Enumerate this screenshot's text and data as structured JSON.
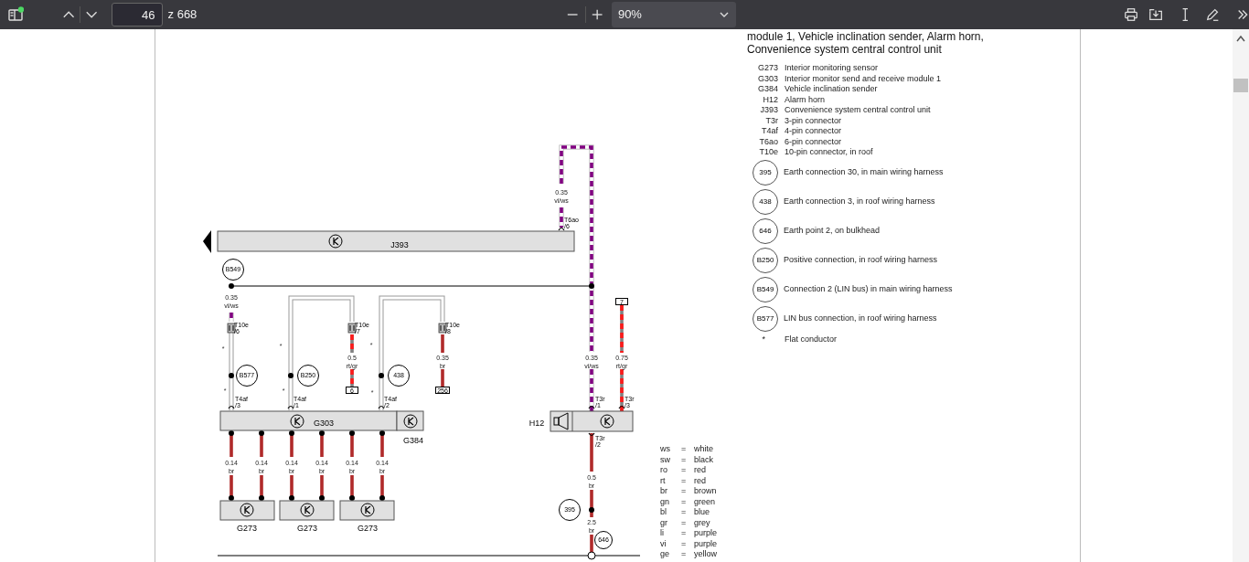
{
  "toolbar": {
    "page_number": "46",
    "page_count": "z 668",
    "zoom": "90%"
  },
  "page": {
    "title": "module 1, Vehicle inclination sender, Alarm horn, Convenience system central control unit",
    "legend": [
      {
        "kind": "code",
        "code": "G273",
        "text": "Interior monitoring sensor"
      },
      {
        "kind": "code",
        "code": "G303",
        "text": "Interior monitor send and receive module 1"
      },
      {
        "kind": "code",
        "code": "G384",
        "text": "Vehicle inclination sender"
      },
      {
        "kind": "code",
        "code": "H12",
        "text": "Alarm horn"
      },
      {
        "kind": "code",
        "code": "J393",
        "text": "Convenience system central control unit"
      },
      {
        "kind": "code",
        "code": "T3r",
        "text": "3-pin connector"
      },
      {
        "kind": "code",
        "code": "T4af",
        "text": "4-pin connector"
      },
      {
        "kind": "code",
        "code": "T6ao",
        "text": "6-pin connector"
      },
      {
        "kind": "code",
        "code": "T10e",
        "text": "10-pin connector, in roof"
      },
      {
        "kind": "circle",
        "code": "395",
        "text": "Earth connection 30, in main wiring harness"
      },
      {
        "kind": "circle",
        "code": "438",
        "text": "Earth connection 3, in roof wiring harness"
      },
      {
        "kind": "circle",
        "code": "646",
        "text": "Earth point 2, on bulkhead"
      },
      {
        "kind": "circle",
        "code": "B250",
        "text": "Positive connection, in roof wiring harness"
      },
      {
        "kind": "circle",
        "code": "B549",
        "text": "Connection 2 (LIN bus) in main wiring harness"
      },
      {
        "kind": "circle",
        "code": "B577",
        "text": "LIN bus connection, in roof wiring harness"
      },
      {
        "kind": "note",
        "code": "*",
        "text": "Flat conductor"
      }
    ],
    "diagram": {
      "units": [
        "J393",
        "G303",
        "G384",
        "H12",
        "G273",
        "G273",
        "G273"
      ],
      "wire_labels": [
        {
          "size": "0.35",
          "insulation": "vi/ws"
        },
        {
          "size": "0.35",
          "insulation": "vi/ws"
        },
        {
          "size": "0.5",
          "insulation": "rt/gr"
        },
        {
          "size": "0.35",
          "insulation": "br"
        },
        {
          "size": "0.35",
          "insulation": "vi/ws"
        },
        {
          "size": "0.75",
          "insulation": "rt/gr"
        },
        {
          "size": "0.14",
          "insulation": "br"
        },
        {
          "size": "0.14",
          "insulation": "br"
        },
        {
          "size": "0.14",
          "insulation": "br"
        },
        {
          "size": "0.14",
          "insulation": "br"
        },
        {
          "size": "0.14",
          "insulation": "br"
        },
        {
          "size": "0.14",
          "insulation": "br"
        },
        {
          "size": "0.5",
          "insulation": "br"
        },
        {
          "size": "2.5",
          "insulation": "br"
        }
      ],
      "connectors": [
        {
          "name": "T6ao",
          "pin": "/6"
        },
        {
          "name": "T10e",
          "pin": "/6"
        },
        {
          "name": "T10e",
          "pin": "/7"
        },
        {
          "name": "T10e",
          "pin": "/8"
        },
        {
          "name": "T4af",
          "pin": "/3"
        },
        {
          "name": "T4af",
          "pin": "/1"
        },
        {
          "name": "T4af",
          "pin": "/2"
        },
        {
          "name": "T3r",
          "pin": "/1"
        },
        {
          "name": "T3r",
          "pin": "/3"
        },
        {
          "name": "T3r",
          "pin": "/2"
        }
      ],
      "junctions": [
        "B549",
        "B577",
        "B250",
        "438",
        "395",
        "646"
      ],
      "terminals": [
        "6",
        "256",
        "7"
      ],
      "flat_marks": [
        "*",
        "*",
        "*",
        "*",
        "*",
        "*"
      ]
    },
    "color_key": [
      {
        "abbr": "ws",
        "eq": "=",
        "name": "white"
      },
      {
        "abbr": "sw",
        "eq": "=",
        "name": "black"
      },
      {
        "abbr": "ro",
        "eq": "=",
        "name": "red"
      },
      {
        "abbr": "rt",
        "eq": "=",
        "name": "red"
      },
      {
        "abbr": "br",
        "eq": "=",
        "name": "brown"
      },
      {
        "abbr": "gn",
        "eq": "=",
        "name": "green"
      },
      {
        "abbr": "bl",
        "eq": "=",
        "name": "blue"
      },
      {
        "abbr": "gr",
        "eq": "=",
        "name": "grey"
      },
      {
        "abbr": "li",
        "eq": "=",
        "name": "purple"
      },
      {
        "abbr": "vi",
        "eq": "=",
        "name": "purple"
      },
      {
        "abbr": "ge",
        "eq": "=",
        "name": "yellow"
      }
    ]
  }
}
